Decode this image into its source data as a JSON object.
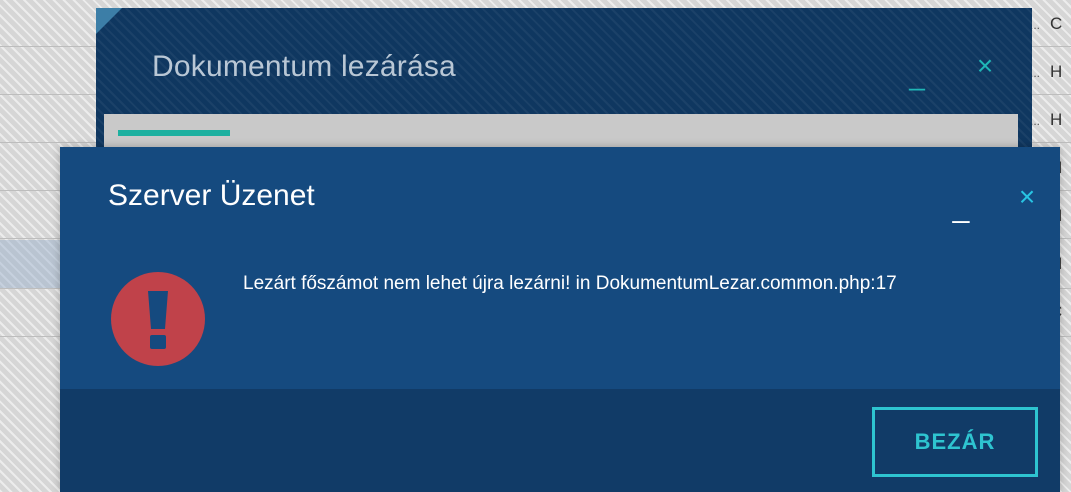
{
  "background": {
    "right_column_letters": [
      "C",
      "H",
      "H",
      "H",
      "H",
      "H",
      "C"
    ],
    "right_column_dots": [
      "...",
      "...",
      "...",
      "",
      "",
      "",
      ""
    ]
  },
  "under_dialog": {
    "title": "Dokumentum lezárása",
    "minimize_glyph": "_",
    "close_glyph": "×"
  },
  "modal": {
    "title": "Szerver Üzenet",
    "minimize_glyph": "_",
    "close_glyph": "×",
    "icon": "exclamation-circle-icon",
    "message": "Lezárt főszámot nem lehet újra lezárni! in DokumentumLezar.common.php:17",
    "close_button_label": "BEZÁR"
  },
  "colors": {
    "modal_bg": "#154a7f",
    "footer_bg": "#113b67",
    "accent_teal": "#2ec4d0",
    "error_red": "#c0424a",
    "progress_green": "#1db0a0"
  }
}
